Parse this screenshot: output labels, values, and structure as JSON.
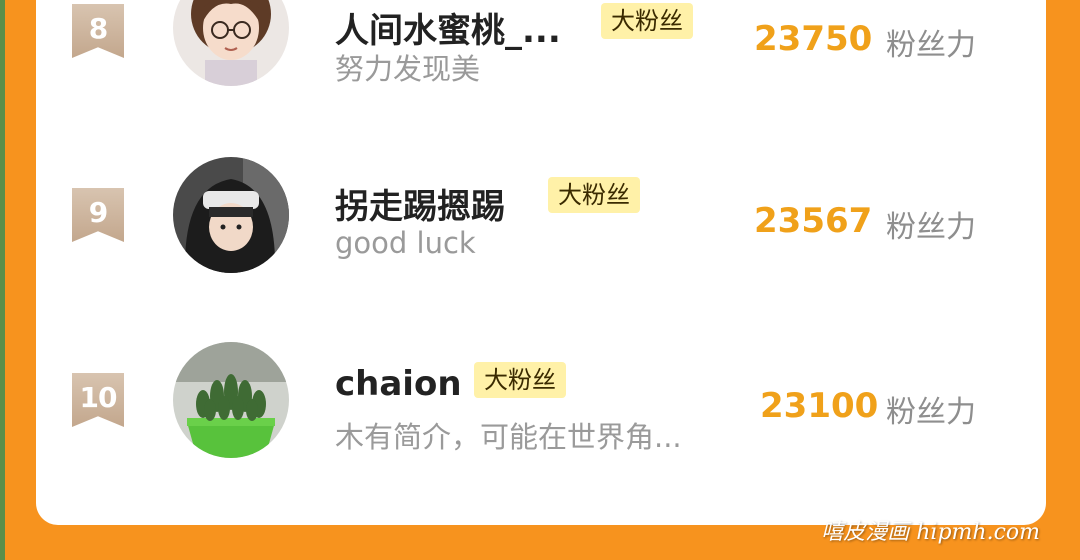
{
  "leaderboard": {
    "unit_label": "粉丝力",
    "items": [
      {
        "rank": "8",
        "name": "人间水蜜桃_...",
        "badge": "大粉丝",
        "bio": "努力发现美",
        "score": "23750",
        "avatar_icon": "anime-girl-avatar"
      },
      {
        "rank": "9",
        "name": "拐走踢摁踢",
        "badge": "大粉丝",
        "bio": "good luck",
        "score": "23567",
        "avatar_icon": "hooded-person-avatar"
      },
      {
        "rank": "10",
        "name": "chaion",
        "badge": "大粉丝",
        "bio": "木有简介，可能在世界角...",
        "score": "23100",
        "avatar_icon": "succulent-plant-avatar"
      }
    ]
  },
  "watermark": "嘻皮漫画 hipmh.com",
  "colors": {
    "background": "#f7931e",
    "score": "#f0a11a",
    "badge_bg": "#fff1a8",
    "rank_badge": "#c9ad93"
  }
}
